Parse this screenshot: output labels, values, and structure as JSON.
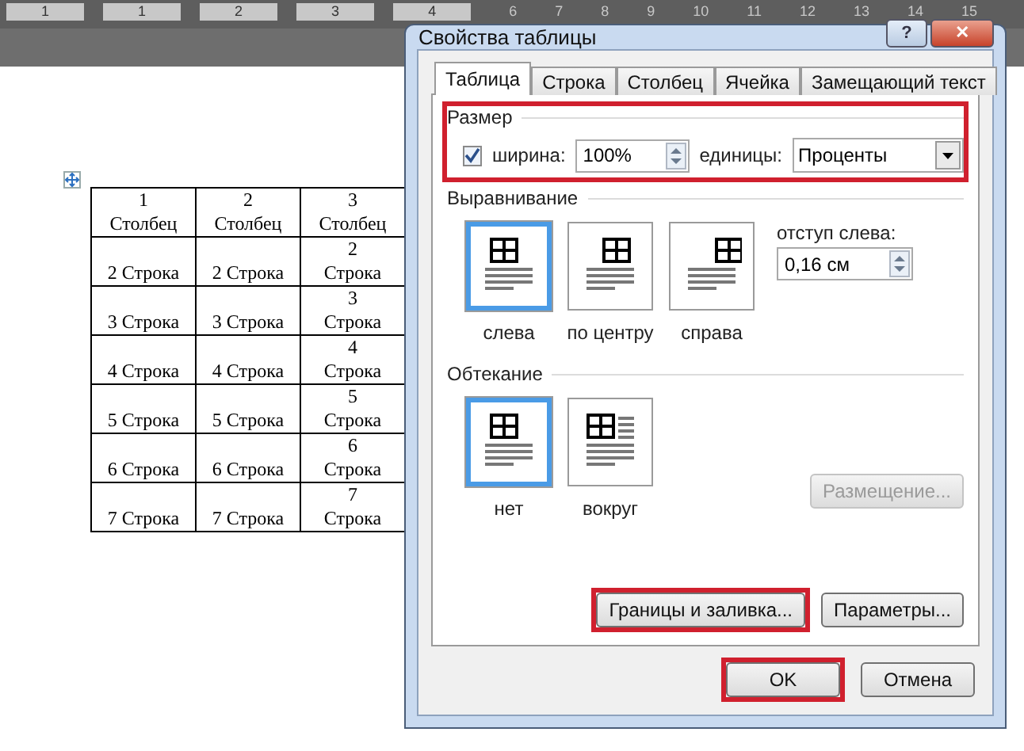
{
  "ruler": {
    "labels": [
      "1",
      "1",
      "2",
      "3",
      "4",
      "6",
      "7",
      "8",
      "9",
      "10",
      "11",
      "12",
      "13",
      "14",
      "15"
    ]
  },
  "document_table": {
    "header": [
      "1\nСтолбец",
      "2\nСтолбец",
      "3\nСтолбец"
    ],
    "rows": [
      [
        "2 Строка",
        "2 Строка",
        "2\nСтрока"
      ],
      [
        "3 Строка",
        "3 Строка",
        "3\nСтрока"
      ],
      [
        "4 Строка",
        "4 Строка",
        "4\nСтрока"
      ],
      [
        "5 Строка",
        "5 Строка",
        "5\nСтрока"
      ],
      [
        "6 Строка",
        "6 Строка",
        "6\nСтрока"
      ],
      [
        "7 Строка",
        "7 Строка",
        "7\nСтрока"
      ]
    ]
  },
  "dialog": {
    "title": "Свойства таблицы",
    "help": "?",
    "close": "✕",
    "tabs": [
      {
        "label": "Таблица",
        "selected": true
      },
      {
        "label": "Строка",
        "selected": false
      },
      {
        "label": "Столбец",
        "selected": false
      },
      {
        "label": "Ячейка",
        "selected": false
      },
      {
        "label": "Замещающий текст",
        "selected": false
      }
    ],
    "size": {
      "label": "Размер",
      "highlighted": true,
      "width_checkbox": {
        "label": "ширина:",
        "checked": true
      },
      "width_value": "100%",
      "units_label": "единицы:",
      "units_value": "Проценты"
    },
    "alignment": {
      "label": "Выравнивание",
      "options": [
        {
          "label": "слева",
          "kind": "left",
          "selected": true
        },
        {
          "label": "по центру",
          "kind": "center",
          "selected": false
        },
        {
          "label": "справа",
          "kind": "right",
          "selected": false
        }
      ],
      "indent_label": "отступ слева:",
      "indent_value": "0,16 см"
    },
    "wrapping": {
      "label": "Обтекание",
      "options": [
        {
          "label": "нет",
          "kind": "none",
          "selected": true
        },
        {
          "label": "вокруг",
          "kind": "around",
          "selected": false
        }
      ],
      "positioning_button": {
        "label": "Размещение...",
        "disabled": true
      }
    },
    "panel_buttons": [
      {
        "label": "Границы и заливка...",
        "highlighted": true
      },
      {
        "label": "Параметры...",
        "highlighted": false
      }
    ],
    "footer_buttons": [
      {
        "label": "OK",
        "highlighted": true
      },
      {
        "label": "Отмена",
        "highlighted": false
      }
    ]
  }
}
